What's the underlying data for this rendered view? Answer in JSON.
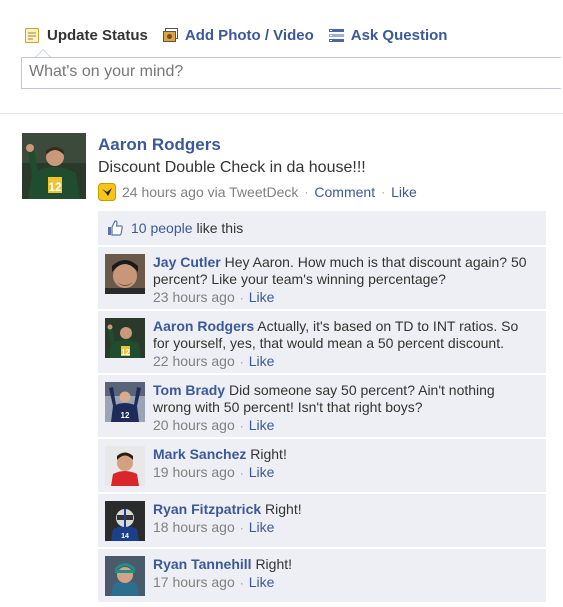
{
  "composer": {
    "tabs": [
      {
        "label": "Update Status",
        "icon": "status-icon"
      },
      {
        "label": "Add Photo / Video",
        "icon": "photo-icon"
      },
      {
        "label": "Ask Question",
        "icon": "question-icon"
      }
    ],
    "placeholder": "What's on your mind?"
  },
  "story": {
    "author": "Aaron Rodgers",
    "message": "Discount Double Check in da house!!!",
    "time": "24 hours ago via TweetDeck",
    "comment_label": "Comment",
    "like_label": "Like"
  },
  "likes": {
    "count": "10 people",
    "suffix": "like this"
  },
  "comments": [
    {
      "author": "Jay Cutler",
      "text": "Hey Aaron. How much is that discount again? 50 percent? Like your team's winning percentage?",
      "time": "23 hours ago",
      "like_label": "Like"
    },
    {
      "author": "Aaron Rodgers",
      "text": "Actually, it's based on TD to INT ratios. So for yourself, yes, that would mean a 50 percent discount.",
      "time": "22 hours ago",
      "like_label": "Like"
    },
    {
      "author": "Tom Brady",
      "text": "Did someone say 50 percent? Ain't nothing wrong with 50 percent! Isn't that right boys?",
      "time": "20 hours ago",
      "like_label": "Like"
    },
    {
      "author": "Mark Sanchez",
      "text": "Right!",
      "time": "19 hours ago",
      "like_label": "Like"
    },
    {
      "author": "Ryan Fitzpatrick",
      "text": "Right!",
      "time": "18 hours ago",
      "like_label": "Like"
    },
    {
      "author": "Ryan Tannehill",
      "text": "Right!",
      "time": "17 hours ago",
      "like_label": "Like"
    }
  ],
  "colors": {
    "link": "#3b5998",
    "ufi_background": "#edeff4",
    "meta_text": "#808080"
  }
}
